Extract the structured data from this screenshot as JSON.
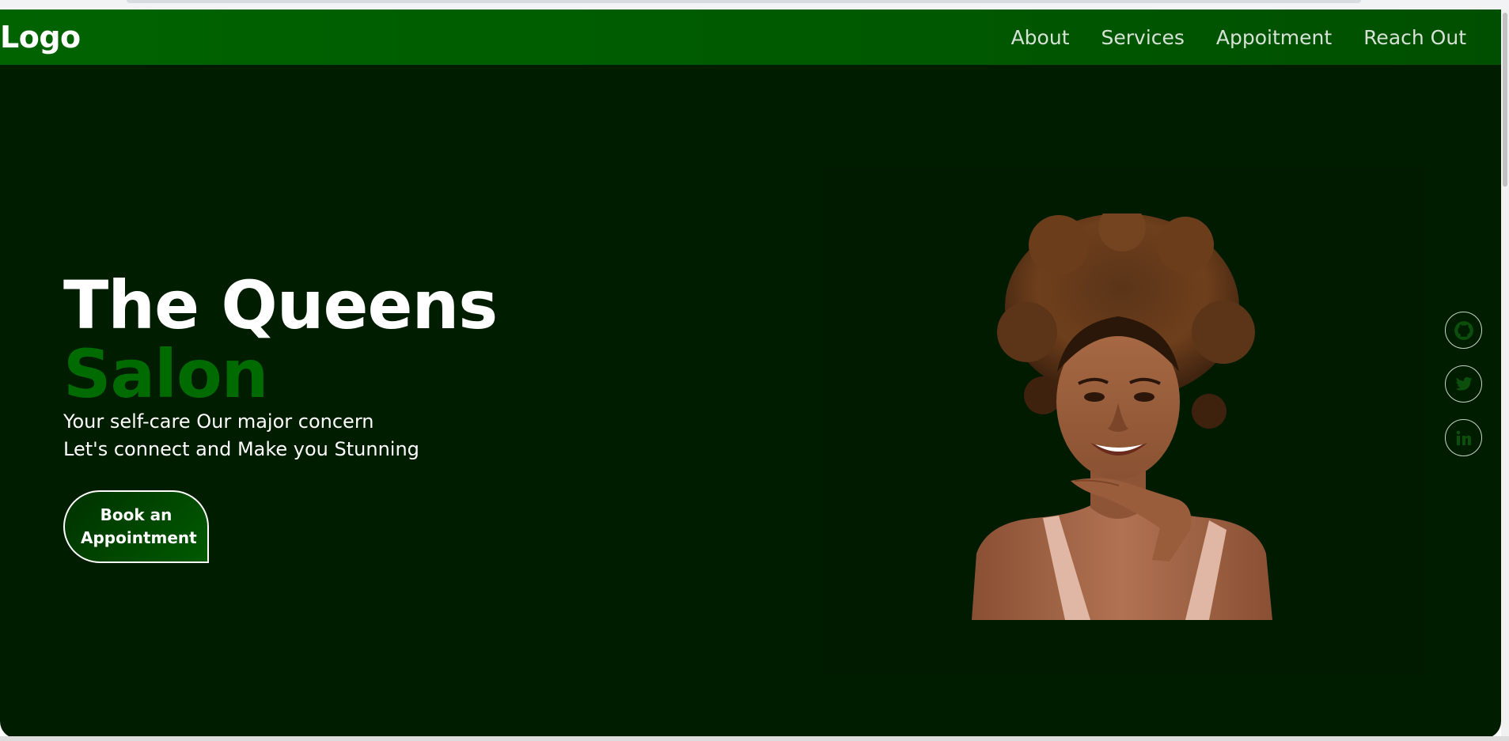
{
  "navbar": {
    "logo": "Logo",
    "links": [
      "About",
      "Services",
      "Appoitment",
      "Reach Out"
    ]
  },
  "hero": {
    "title_line1": "The Queens",
    "title_line2": "Salon",
    "tagline_line1": "Your self-care Our major concern",
    "tagline_line2": "Let's connect and Make you Stunning",
    "cta_label": "Book an Appointment"
  },
  "social": [
    {
      "icon": "github-icon"
    },
    {
      "icon": "twitter-icon"
    },
    {
      "icon": "linkedin-icon"
    }
  ],
  "colors": {
    "background": "#001d00",
    "navbar": "#005a00",
    "accent": "#006b00",
    "text": "#ffffff"
  }
}
